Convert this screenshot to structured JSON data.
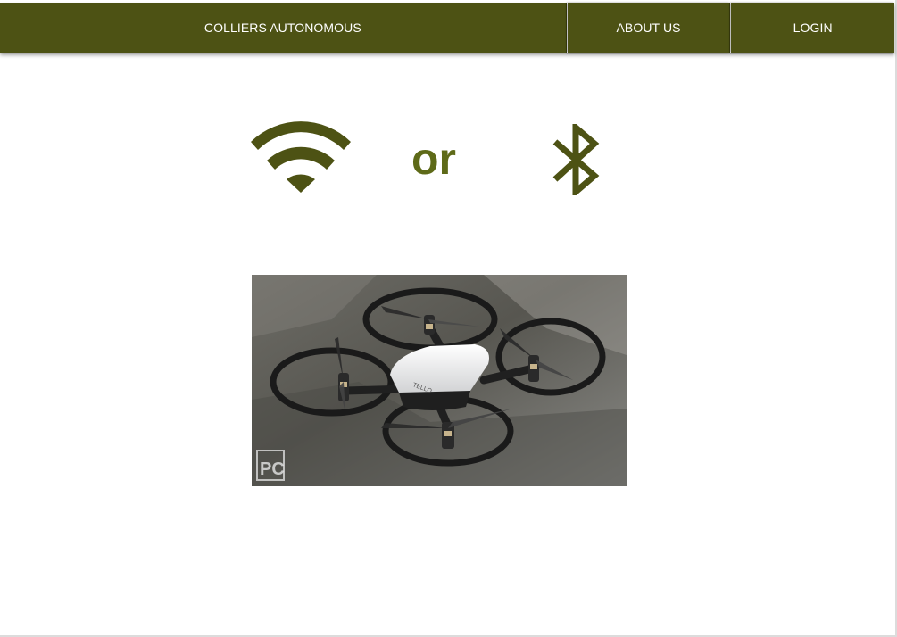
{
  "navbar": {
    "brand_label": "COLLIERS AUTONOMOUS",
    "about_label": "ABOUT US",
    "login_label": "LOGIN"
  },
  "connection": {
    "wifi_icon": "wifi-icon",
    "separator_text": "or",
    "bluetooth_icon": "bluetooth-icon"
  },
  "photo": {
    "drone_label": "TELLO",
    "watermark_text": "PC"
  },
  "colors": {
    "nav_bg": "#4d5214",
    "icon_color": "#4d5214",
    "or_color": "#5e6a18"
  }
}
